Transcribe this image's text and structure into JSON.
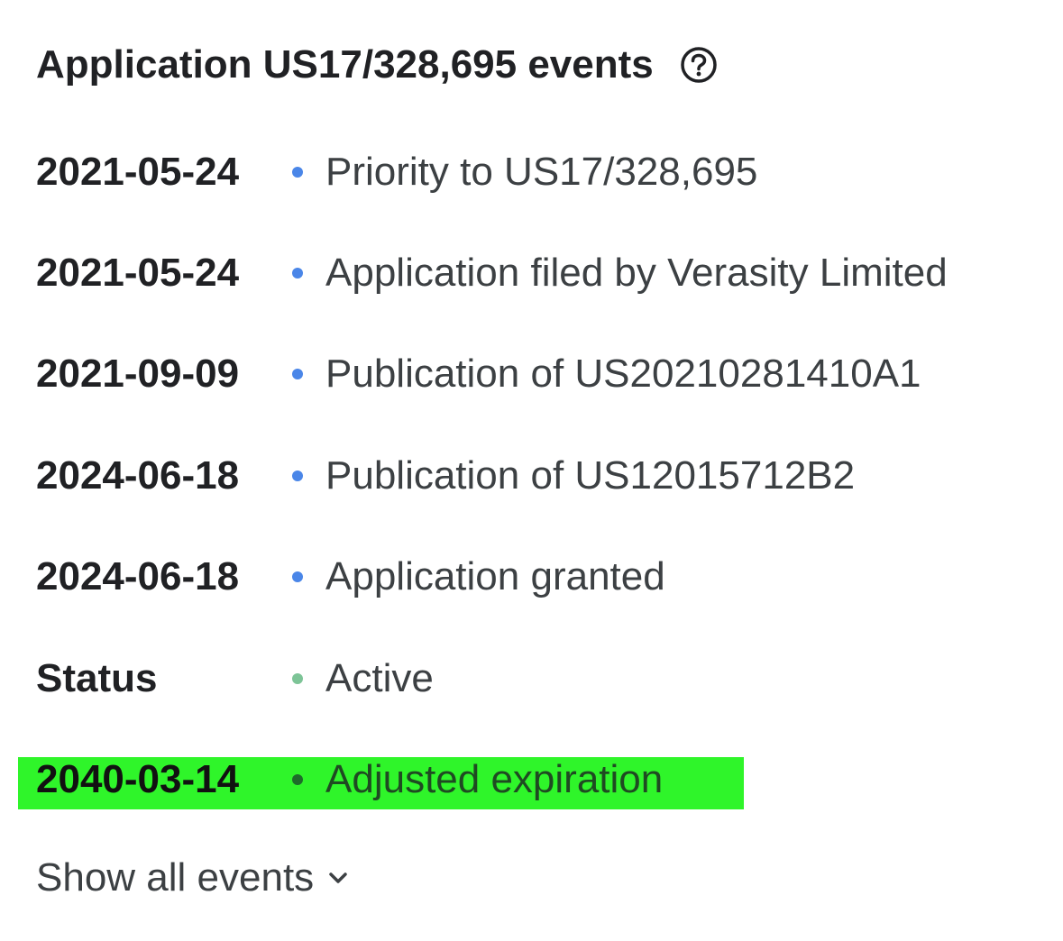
{
  "header": {
    "title": "Application US17/328,695 events",
    "help_icon": "help-circle-icon"
  },
  "events": [
    {
      "date": "2021-05-24",
      "text": "Priority to US17/328,695",
      "bullet_color": "#4a86e8"
    },
    {
      "date": "2021-05-24",
      "text": "Application filed by Verasity Limited",
      "bullet_color": "#4a86e8"
    },
    {
      "date": "2021-09-09",
      "text": "Publication of US20210281410A1",
      "bullet_color": "#4a86e8"
    },
    {
      "date": "2024-06-18",
      "text": "Publication of US12015712B2",
      "bullet_color": "#4a86e8"
    },
    {
      "date": "2024-06-18",
      "text": "Application granted",
      "bullet_color": "#4a86e8"
    },
    {
      "date": "Status",
      "text": "Active",
      "bullet_color": "#7dc497"
    },
    {
      "date": "2040-03-14",
      "text": "Adjusted expiration",
      "bullet_color": "#1e6b2a"
    }
  ],
  "highlight_color": "#2ff52a",
  "show_all": {
    "label": "Show all events",
    "icon": "chevron-down-icon"
  }
}
